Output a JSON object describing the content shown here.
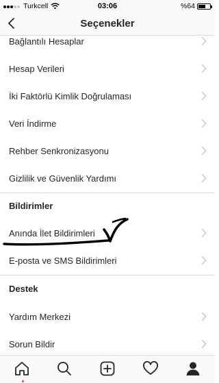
{
  "status_bar": {
    "carrier": "Turkcell",
    "time": "03:06",
    "battery_text": "%64",
    "battery_level": 0.64
  },
  "header": {
    "title": "Seçenekler",
    "back_icon": "chevron-left-icon"
  },
  "account_items": [
    {
      "label": "Bağlantılı Hesaplar"
    },
    {
      "label": "Hesap Verileri"
    },
    {
      "label": "İki Faktörlü Kimlik Doğrulaması"
    },
    {
      "label": "Veri İndirme"
    },
    {
      "label": "Rehber Senkronizasyonu"
    },
    {
      "label": "Gizlilik ve Güvenlik Yardımı"
    }
  ],
  "notifications": {
    "section_title": "Bildirimler",
    "items": [
      {
        "label": "Anında İlet Bildirimleri"
      },
      {
        "label": "E-posta ve SMS Bildirimleri"
      }
    ]
  },
  "support": {
    "section_title": "Destek",
    "items": [
      {
        "label": "Yardım Merkezi"
      },
      {
        "label": "Sorun Bildir"
      }
    ]
  },
  "tab_bar": {
    "tabs": [
      "home-icon",
      "search-icon",
      "new-post-icon",
      "activity-heart-icon",
      "profile-icon"
    ],
    "active": "home-icon",
    "accent": "#262626",
    "notification_dot_color": "#ed4956"
  },
  "annotation_color": "#000000"
}
